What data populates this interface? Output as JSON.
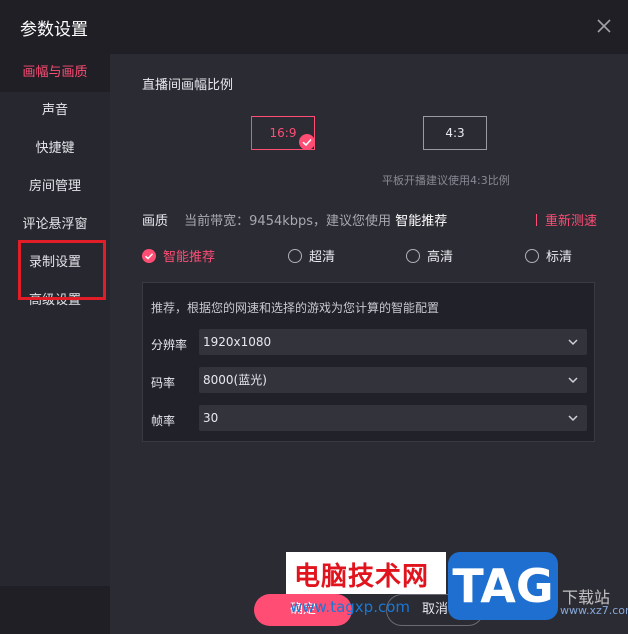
{
  "window": {
    "title": "参数设置"
  },
  "sidebar": {
    "items": [
      {
        "label": "画幅与画质"
      },
      {
        "label": "声音"
      },
      {
        "label": "快捷键"
      },
      {
        "label": "房间管理"
      },
      {
        "label": "评论悬浮窗"
      },
      {
        "label": "录制设置"
      },
      {
        "label": "高级设置"
      }
    ]
  },
  "ratio": {
    "title": "直播间画幅比例",
    "options": [
      {
        "label": "16:9"
      },
      {
        "label": "4:3"
      }
    ],
    "selected": "16:9",
    "hint": "平板开播建议使用4:3比例"
  },
  "quality": {
    "label": "画质",
    "bandwidth": "当前带宽：9454kbps，建议您使用",
    "recommend": "智能推荐",
    "retest": "重新测速",
    "options": [
      {
        "label": "智能推荐"
      },
      {
        "label": "超清"
      },
      {
        "label": "高清"
      },
      {
        "label": "标清"
      }
    ],
    "selected": "智能推荐",
    "panel_desc": "推荐，根据您的网速和选择的游戏为您计算的智能配置",
    "resolution": {
      "label": "分辨率",
      "value": "1920x1080"
    },
    "bitrate": {
      "label": "码率",
      "value": "8000(蓝光)"
    },
    "framerate": {
      "label": "帧率",
      "value": "30"
    }
  },
  "footer": {
    "ok_label": "确定",
    "cancel_label": "取消"
  },
  "watermark": {
    "site_name": "电脑技术网",
    "url": "www.tagxp.com",
    "tag": "TAG",
    "xz_name": "下载站",
    "xz_url": "www.xz7.com"
  },
  "colors": {
    "accent": "#ff4d74",
    "bg": "#1f1f25",
    "panel": "#2b2b33"
  }
}
